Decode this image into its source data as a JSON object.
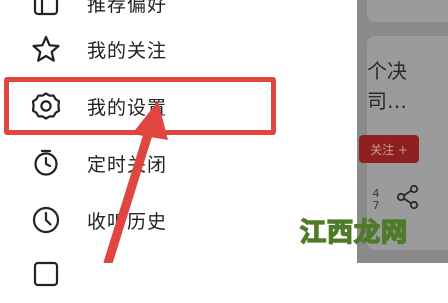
{
  "drawer": {
    "items": [
      {
        "label": "推荐偏好",
        "icon": "preference-icon"
      },
      {
        "label": "我的关注",
        "icon": "star-icon"
      },
      {
        "label": "我的设置",
        "icon": "gear-icon"
      },
      {
        "label": "定时关闭",
        "icon": "timer-icon"
      },
      {
        "label": "收听历史",
        "icon": "clock-icon"
      },
      {
        "label": "",
        "icon": "menu-item-icon"
      }
    ]
  },
  "background": {
    "card_title": "个决\n司…",
    "follow_label": "关注 +",
    "stat_text": "4\n7"
  },
  "watermark": "江西龙网",
  "colors": {
    "highlight": "#e0463f",
    "follow_button": "#8e2020",
    "overlay": "#8a8a8a"
  }
}
